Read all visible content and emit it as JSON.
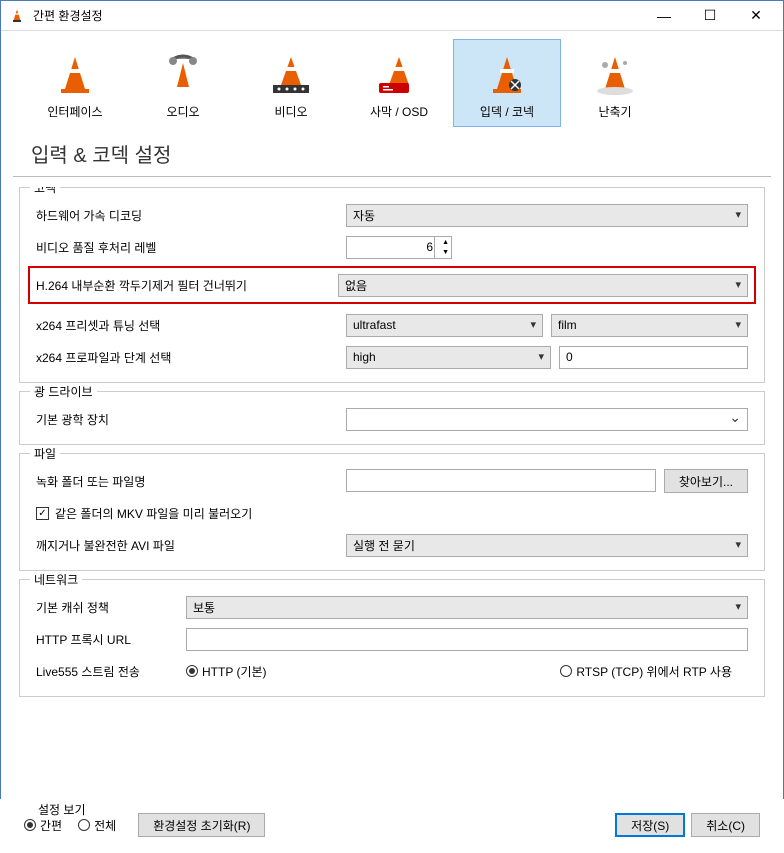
{
  "window": {
    "title": "간편 환경설정"
  },
  "tabs": {
    "interface": "인터페이스",
    "audio": "오디오",
    "video": "비디오",
    "subtitles": "사막 / OSD",
    "input_codec": "입덱 / 코넥",
    "hotkeys": "난축기"
  },
  "heading": "입력 & 코덱 설정",
  "codec": {
    "group": "코덱",
    "hw_decode_label": "하드웨어 가속 디코딩",
    "hw_decode_value": "자동",
    "postproc_label": "비디오 품질 후처리 레벨",
    "postproc_value": "6",
    "h264_loopfilter_label": "H.264 내부순환 깍두기제거 필터 건너뛰기",
    "h264_loopfilter_value": "없음",
    "x264_preset_label": "x264 프리셋과 튜닝 선택",
    "x264_preset_value": "ultrafast",
    "x264_tune_value": "film",
    "x264_profile_label": "x264 프로파일과 단계 선택",
    "x264_profile_value": "high",
    "x264_level_value": "0"
  },
  "optical": {
    "group": "광 드라이브",
    "device_label": "기본 광학 장치",
    "device_value": ""
  },
  "file": {
    "group": "파일",
    "record_label": "녹화 폴더 또는 파일명",
    "record_value": "",
    "browse": "찾아보기...",
    "mkv_preload": "같은 폴더의 MKV 파일을 미리 불러오기",
    "avi_label": "깨지거나 불완전한 AVI 파일",
    "avi_value": "실행 전 묻기"
  },
  "network": {
    "group": "네트워크",
    "cache_label": "기본 캐쉬 정책",
    "cache_value": "보통",
    "proxy_label": "HTTP 프록시 URL",
    "proxy_value": "",
    "live555_label": "Live555 스트림 전송",
    "http_default": "HTTP (기본)",
    "rtsp_tcp": "RTSP (TCP) 위에서 RTP 사용"
  },
  "footer": {
    "settings_view": "설정 보기",
    "simple": "간편",
    "all": "전체",
    "reset": "환경설정 초기화(R)",
    "save": "저장(S)",
    "cancel": "취소(C)"
  }
}
